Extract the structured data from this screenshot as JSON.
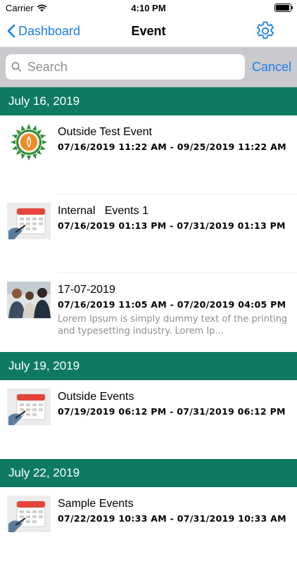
{
  "status_bar": {
    "carrier": "Carrier",
    "time": "4:10 PM"
  },
  "nav": {
    "back_label": "Dashboard",
    "title": "Event"
  },
  "search": {
    "placeholder": "Search",
    "value": "",
    "cancel_label": "Cancel"
  },
  "sections": [
    {
      "date": "July 16, 2019",
      "events": [
        {
          "title": "Outside Test Event",
          "dates": "07/16/2019 11:22 AM - 09/25/2019 11:22 AM",
          "description": "",
          "thumbnail": "logo-icon"
        },
        {
          "title": "Internal   Events 1",
          "dates": "07/16/2019 01:13 PM - 07/31/2019 01:13 PM",
          "description": "",
          "thumbnail": "calendar-icon"
        },
        {
          "title": "17-07-2019",
          "dates": "07/16/2019 11:05 AM - 07/20/2019 04:05 PM",
          "description": "Lorem Ipsum is simply dummy text of the printing and typesetting industry. Lorem Ip...",
          "thumbnail": "photo-people"
        }
      ]
    },
    {
      "date": "July 19, 2019",
      "events": [
        {
          "title": "Outside Events",
          "dates": "07/19/2019 06:12 PM - 07/31/2019 06:12 PM",
          "description": "",
          "thumbnail": "calendar-icon"
        }
      ]
    },
    {
      "date": "July 22, 2019",
      "events": [
        {
          "title": "Sample Events",
          "dates": "07/22/2019 10:33 AM - 07/31/2019 10:33 AM",
          "description": "",
          "thumbnail": "calendar-icon"
        }
      ]
    }
  ],
  "colors": {
    "section_header": "#0f7a64",
    "accent": "#1a7ee8",
    "search_bar_bg": "#c9c9ce"
  }
}
